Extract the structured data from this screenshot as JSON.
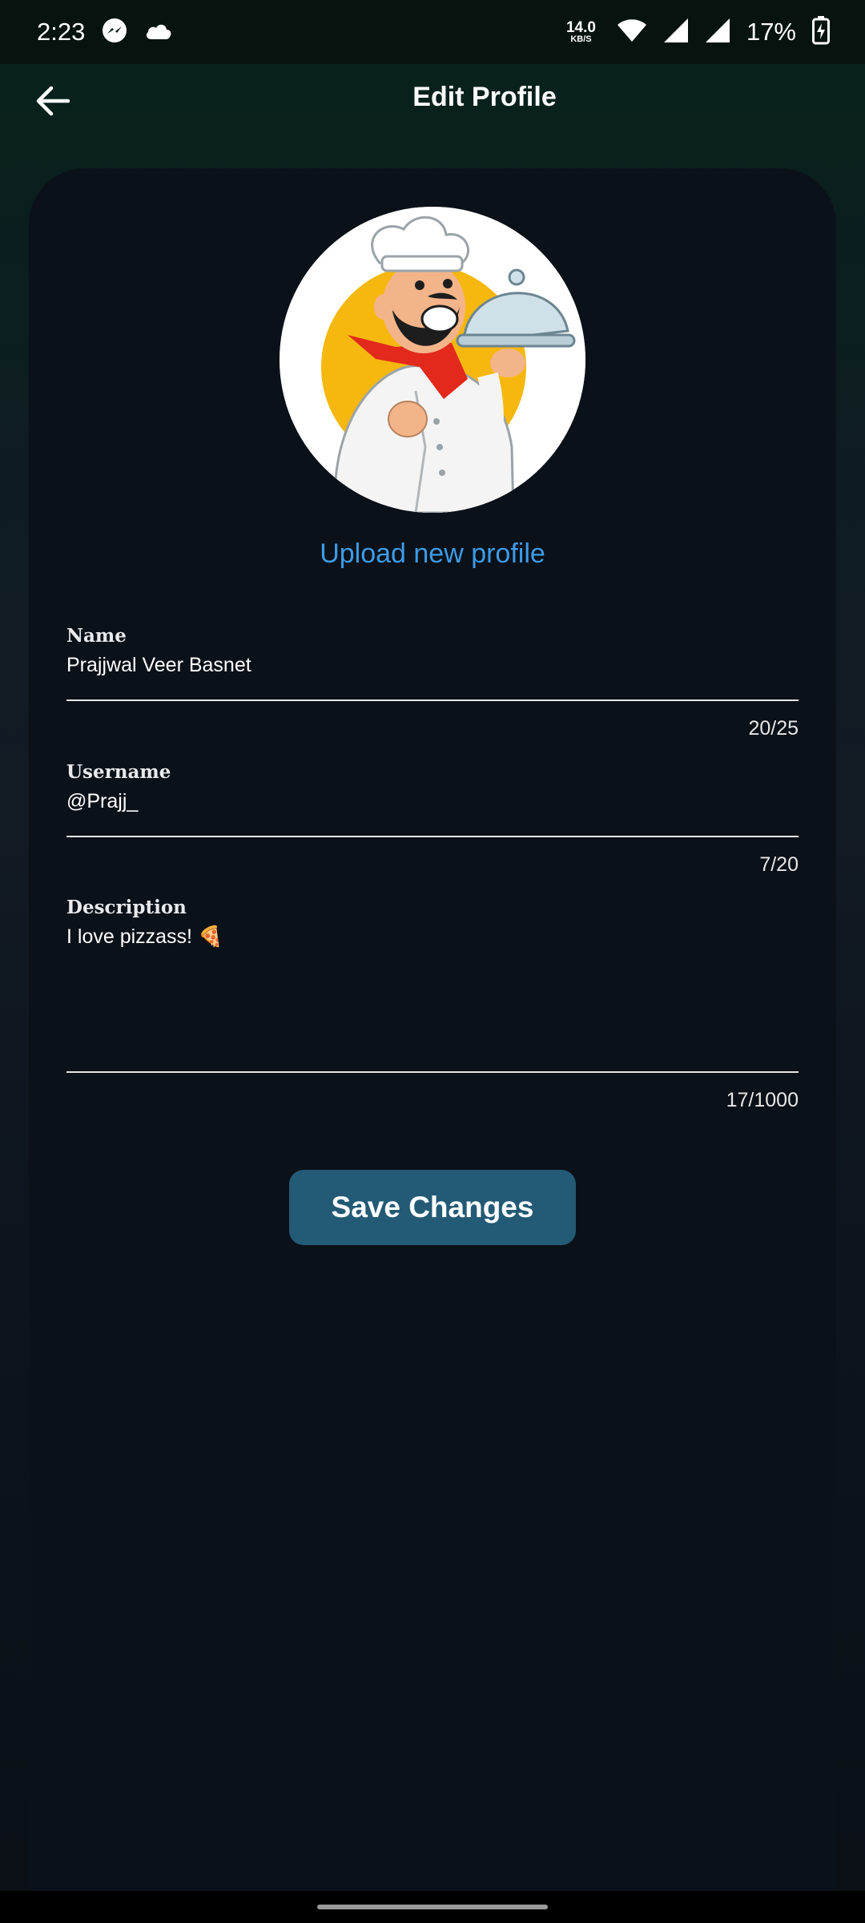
{
  "status_bar": {
    "time": "2:23",
    "net_speed_value": "14.0",
    "net_speed_unit": "KB/S",
    "battery": "17%",
    "icons": [
      "messenger-icon",
      "cloud-icon",
      "wifi-icon",
      "signal-icon",
      "signal-icon",
      "battery-charging-icon"
    ]
  },
  "app_bar": {
    "title": "Edit Profile",
    "back_icon": "arrow-back-icon"
  },
  "profile": {
    "upload_label": "Upload new profile",
    "avatar": "chef-avatar"
  },
  "fields": {
    "name": {
      "label": "Name",
      "value": "Prajjwal Veer Basnet",
      "counter": "20/25"
    },
    "username": {
      "label": "Username",
      "value": "@Prajj_",
      "counter": "7/20"
    },
    "description": {
      "label": "Description",
      "value": "I love pizzass! 🍕",
      "counter": "17/1000"
    }
  },
  "actions": {
    "save_label": "Save Changes"
  },
  "colors": {
    "accent_link": "#3d9be9",
    "button": "#235a75",
    "card": "#0b1118"
  }
}
